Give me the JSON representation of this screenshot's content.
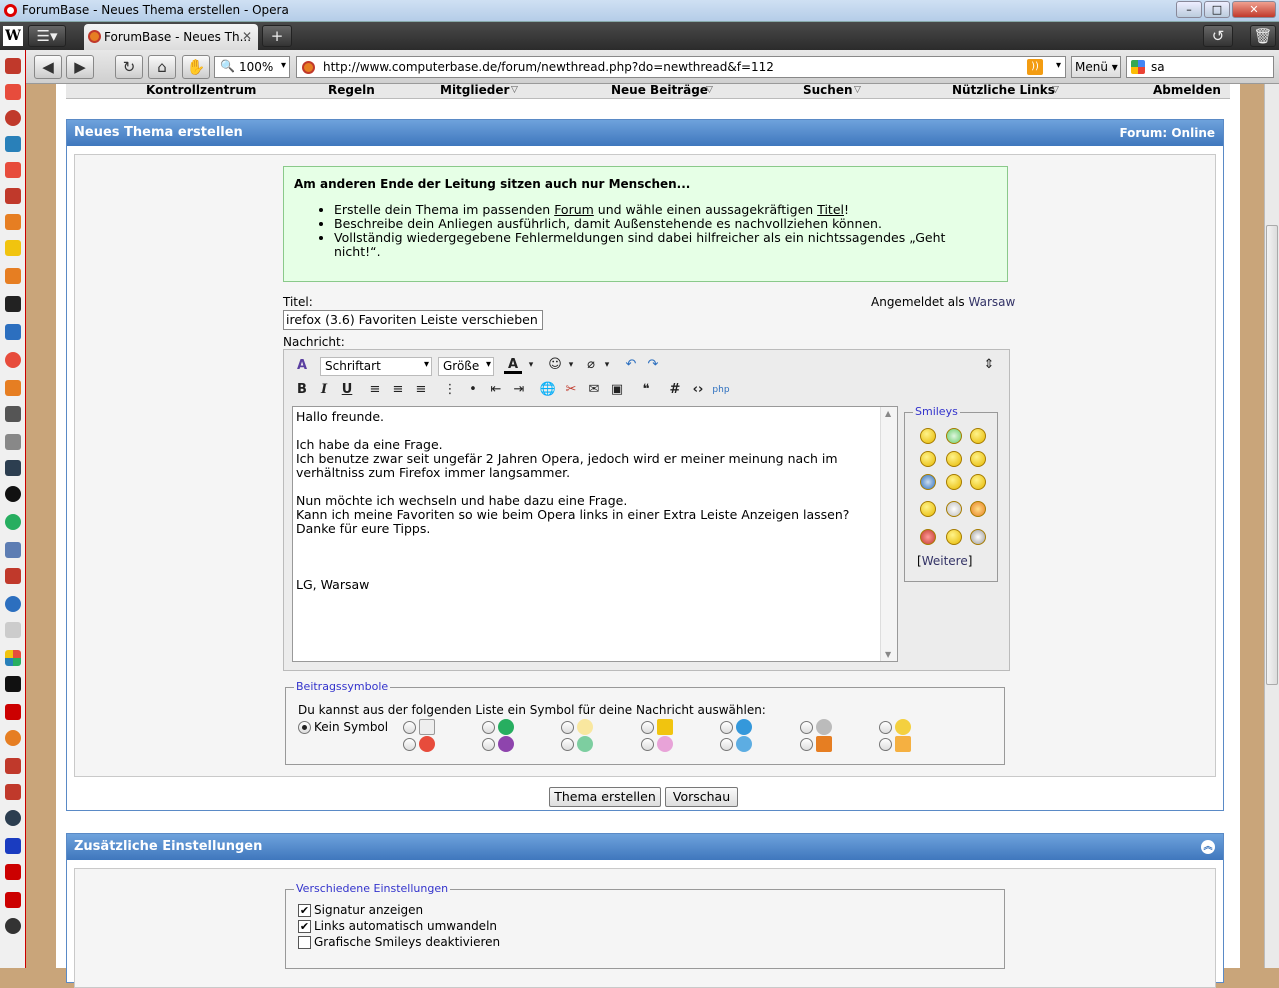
{
  "window": {
    "title": "ForumBase - Neues Thema erstellen - Opera"
  },
  "tabs": [
    {
      "label": "ForumBase - Neues Th..."
    }
  ],
  "toolbar": {
    "zoom": "100%",
    "url": "http://www.computerbase.de/forum/newthread.php?do=newthread&f=112",
    "menu_label": "Menü",
    "search_value": "sa"
  },
  "nav": {
    "items": [
      "Kontrollzentrum",
      "Regeln",
      "Mitglieder",
      "Neue Beiträge",
      "Suchen",
      "Nützliche Links",
      "Abmelden"
    ]
  },
  "panel": {
    "title": "Neues Thema erstellen",
    "forum_label": "Forum:",
    "forum_status": "Online"
  },
  "notice": {
    "heading": "Am anderen Ende der Leitung sitzen auch nur Menschen...",
    "b1_pre": "Erstelle dein Thema im passenden ",
    "b1_link1": "Forum",
    "b1_mid": " und wähle einen aussagekräftigen ",
    "b1_link2": "Titel",
    "b1_post": "!",
    "b2": "Beschreibe dein Anliegen ausführlich, damit Außenstehende es nachvollziehen können.",
    "b3": "Vollständig wiedergegebene Fehlermeldungen sind dabei hilfreicher als ein nichtssagendes „Geht nicht!“."
  },
  "form": {
    "title_label": "Titel:",
    "title_value": "irefox (3.6) Favoriten Leiste verschieben",
    "logged_in_label": "Angemeldet als",
    "logged_in_user": "Warsaw",
    "message_label": "Nachricht:",
    "font_combo": "Schriftart",
    "size_combo": "Größe",
    "message": "Hallo freunde.\n\nIch habe da eine Frage.\nIch benutze zwar seit ungefär 2 Jahren Opera, jedoch wird er meiner meinung nach im\nverhältniss zum Firefox immer langsammer.\n\nNun möchte ich wechseln und habe dazu eine Frage.\nKann ich meine Favoriten so wie beim Opera links in einer Extra Leiste Anzeigen lassen?\nDanke für eure Tipps.\n\n\n\nLG, Warsaw",
    "smileys_legend": "Smileys",
    "smileys_more": "Weitere"
  },
  "post_icons": {
    "legend": "Beitragssymbole",
    "hint": "Du kannst aus der folgenden Liste ein Symbol für deine Nachricht auswählen:",
    "none_label": "Kein Symbol"
  },
  "buttons": {
    "submit": "Thema erstellen",
    "preview": "Vorschau"
  },
  "extra": {
    "title": "Zusätzliche Einstellungen",
    "legend": "Verschiedene Einstellungen",
    "opt1": "Signatur anzeigen",
    "opt2": "Links automatisch umwandeln",
    "opt3": "Grafische Smileys deaktivieren"
  },
  "colors": {
    "panel_header": "#3f77bd",
    "notice_bg": "#e6ffe6",
    "page_bg": "#c9a57a"
  }
}
